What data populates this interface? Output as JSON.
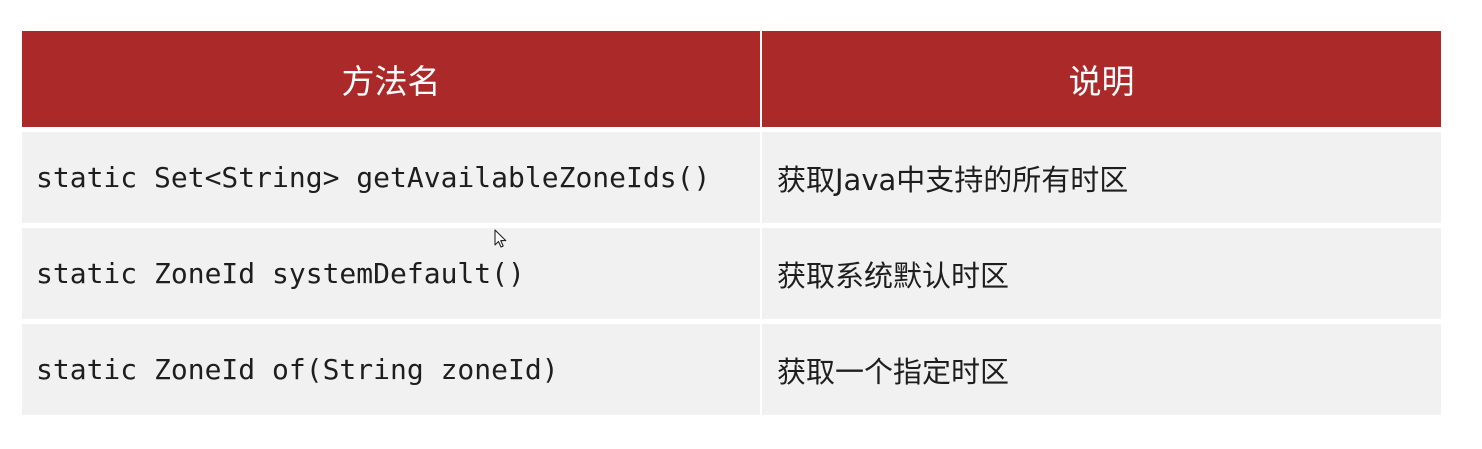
{
  "table": {
    "headers": [
      "方法名",
      "说明"
    ],
    "rows": [
      {
        "method": "static Set<String> getAvailableZoneIds()",
        "description": "获取Java中支持的所有时区"
      },
      {
        "method": "static ZoneId systemDefault()",
        "description": "获取系统默认时区"
      },
      {
        "method": "static ZoneId of(String zoneId)",
        "description": "获取一个指定时区"
      }
    ]
  },
  "colors": {
    "header_bg": "#ab2a29",
    "header_text": "#ffffff",
    "row_bg": "#f1f1f1"
  },
  "icons": {
    "cursor": "mouse-pointer-icon"
  }
}
